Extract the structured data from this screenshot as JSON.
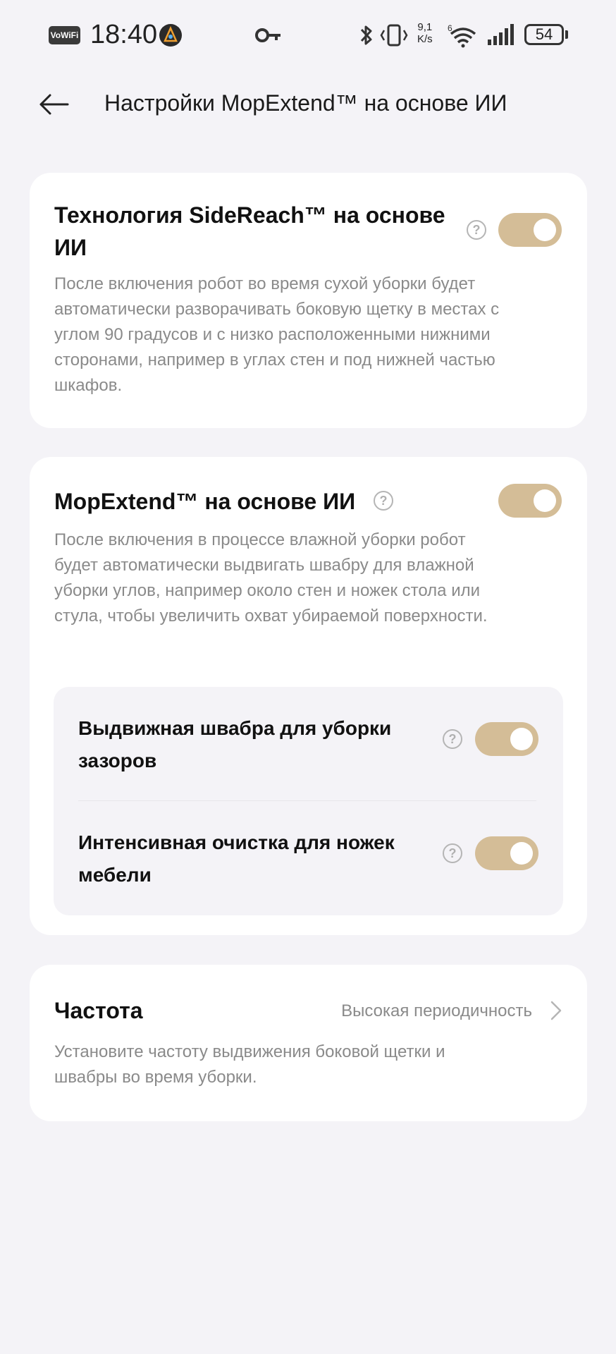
{
  "status_bar": {
    "network_badge": "VoWiFi",
    "time": "18:40",
    "speed_value": "9,1",
    "speed_unit": "K/s",
    "battery": "54"
  },
  "header": {
    "title": "Настройки MopExtend™ на основе ИИ"
  },
  "sidereach": {
    "title": "Технология SideReach™ на основе ИИ",
    "description": "После включения робот во время сухой уборки будет автоматически разворачивать боковую щетку в местах с углом 90 градусов и с низко расположенными нижними сторонами, например в углах стен и под нижней частью шкафов.",
    "enabled": true
  },
  "mopextend": {
    "title": "MopExtend™ на основе ИИ",
    "description": "После включения в процессе влажной уборки робот будет автоматически выдвигать швабру для влажной уборки углов, например около стен и ножек стола или стула, чтобы увеличить охват убираемой поверхности.",
    "enabled": true,
    "sub_options": [
      {
        "label": "Выдвижная швабра для уборки зазоров",
        "enabled": true
      },
      {
        "label": "Интенсивная очистка для ножек мебели",
        "enabled": true
      }
    ]
  },
  "frequency": {
    "title": "Частота",
    "value": "Высокая периодичность",
    "description": "Установите частоту выдвижения боковой щетки и швабры во время уборки."
  },
  "colors": {
    "background": "#f4f3f7",
    "card": "#ffffff",
    "toggle_on": "#d4bd97",
    "secondary_text": "#8a8a8a"
  },
  "icons": {
    "back": "arrow-left-icon",
    "help": "question-circle-icon",
    "chevron": "chevron-right-icon"
  }
}
